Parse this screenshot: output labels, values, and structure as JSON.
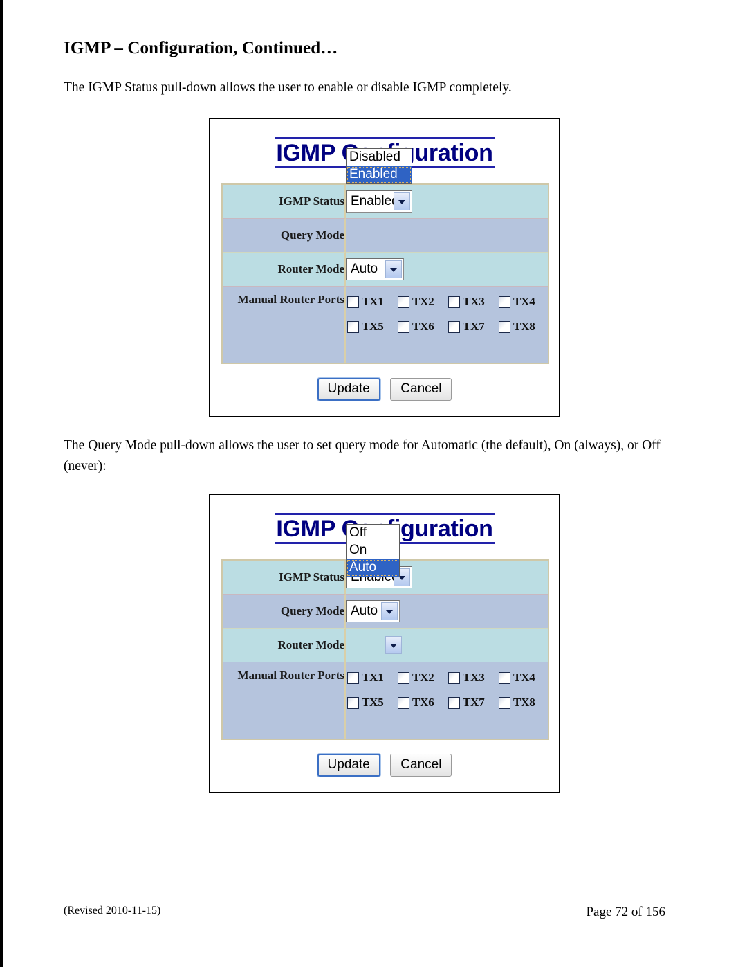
{
  "document": {
    "heading": "IGMP – Configuration, Continued…",
    "paragraph_1": "The IGMP Status pull-down allows the user to enable or disable IGMP completely.",
    "paragraph_2": "The Query Mode pull-down allows the user to set query mode for Automatic (the default), On (always), or Off (never):"
  },
  "footer": {
    "revised": "(Revised 2010-11-15)",
    "page": "Page 72 of 156"
  },
  "colors": {
    "title_navy": "#000080",
    "row_cyan": "#bbdde3",
    "row_blue": "#b5c4dd",
    "table_border": "#cfc8a8",
    "highlight_blue": "#2f63c4",
    "default_button_border": "#3b6fc4"
  },
  "figure_1": {
    "title": "IGMP Configuration",
    "rows": {
      "igmp_status_label": "IGMP Status",
      "query_mode_label": "Query Mode",
      "router_mode_label": "Router Mode",
      "manual_router_ports_label": "Manual Router Ports"
    },
    "igmp_status": {
      "value": "Enabled",
      "open": true,
      "options": [
        "Disabled",
        "Enabled"
      ],
      "selected_option": "Enabled"
    },
    "query_mode": {
      "value": "",
      "open": false
    },
    "router_mode": {
      "value": "Auto",
      "open": false
    },
    "ports": [
      {
        "label": "TX1",
        "checked": false
      },
      {
        "label": "TX2",
        "checked": false
      },
      {
        "label": "TX3",
        "checked": false
      },
      {
        "label": "TX4",
        "checked": false
      },
      {
        "label": "TX5",
        "checked": false
      },
      {
        "label": "TX6",
        "checked": false
      },
      {
        "label": "TX7",
        "checked": false
      },
      {
        "label": "TX8",
        "checked": false
      }
    ],
    "buttons": {
      "update": "Update",
      "cancel": "Cancel"
    }
  },
  "figure_2": {
    "title": "IGMP Configuration",
    "rows": {
      "igmp_status_label": "IGMP Status",
      "query_mode_label": "Query Mode",
      "router_mode_label": "Router Mode",
      "manual_router_ports_label": "Manual Router Ports"
    },
    "igmp_status": {
      "value": "Enabled",
      "open": false
    },
    "query_mode": {
      "value": "Auto",
      "open": true,
      "options": [
        "Off",
        "On",
        "Auto"
      ],
      "selected_option": "Auto"
    },
    "router_mode": {
      "value": "",
      "open": false
    },
    "ports": [
      {
        "label": "TX1",
        "checked": false
      },
      {
        "label": "TX2",
        "checked": false
      },
      {
        "label": "TX3",
        "checked": false
      },
      {
        "label": "TX4",
        "checked": false
      },
      {
        "label": "TX5",
        "checked": false
      },
      {
        "label": "TX6",
        "checked": false
      },
      {
        "label": "TX7",
        "checked": false
      },
      {
        "label": "TX8",
        "checked": false
      }
    ],
    "buttons": {
      "update": "Update",
      "cancel": "Cancel"
    }
  }
}
